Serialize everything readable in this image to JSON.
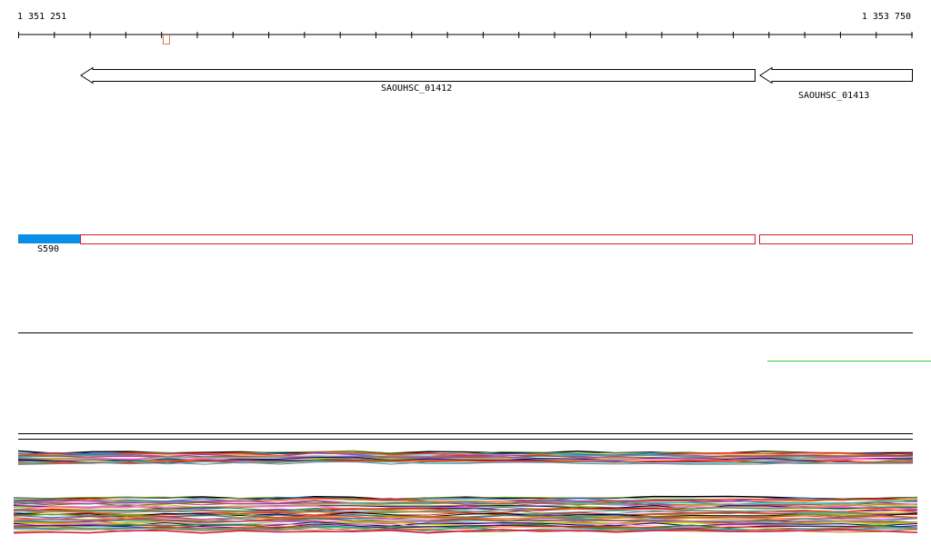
{
  "ruler": {
    "start_label": "1 351 251",
    "end_label": "1 353 750"
  },
  "genes": [
    {
      "name": "SAOUHSC_01412",
      "strand": "-"
    },
    {
      "name": "SAOUHSC_01413",
      "strand": "-"
    }
  ],
  "features": [
    {
      "name": "S590",
      "color": "#0b8fe6"
    }
  ],
  "colors": {
    "gene_outline": "#000000",
    "feature_outline": "#d21e1e",
    "feature_fill": "#0b8fe6",
    "tick_marker": "#d9774e",
    "green_line": "#33cc33"
  },
  "icons": {
    "gene_arrow": "left-arrow-icon",
    "position_marker": "tick-marker-icon"
  }
}
